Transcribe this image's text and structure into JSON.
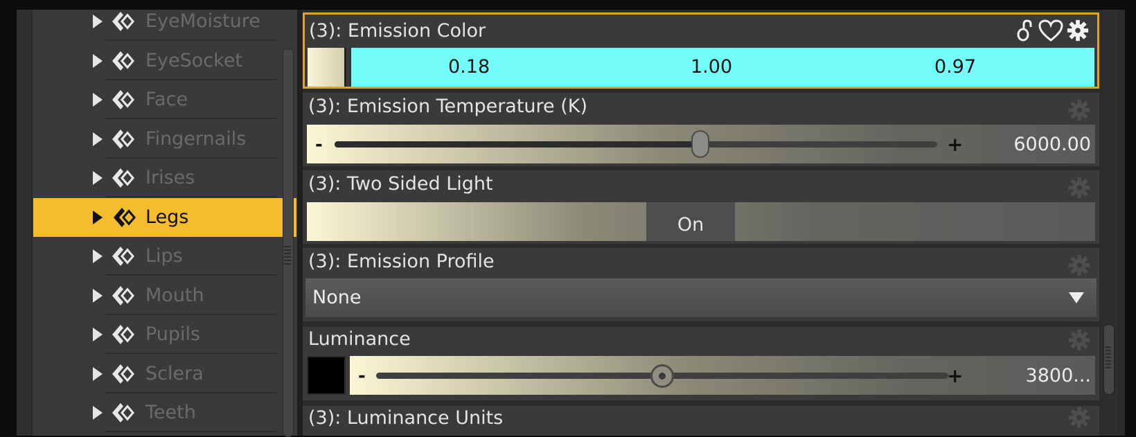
{
  "tree": {
    "items": [
      {
        "label": "EyeMoisture",
        "selected": false
      },
      {
        "label": "EyeSocket",
        "selected": false
      },
      {
        "label": "Face",
        "selected": false
      },
      {
        "label": "Fingernails",
        "selected": false
      },
      {
        "label": "Irises",
        "selected": false
      },
      {
        "label": "Legs",
        "selected": true
      },
      {
        "label": "Lips",
        "selected": false
      },
      {
        "label": "Mouth",
        "selected": false
      },
      {
        "label": "Pupils",
        "selected": false
      },
      {
        "label": "Sclera",
        "selected": false
      },
      {
        "label": "Teeth",
        "selected": false
      }
    ]
  },
  "properties": {
    "emission_color": {
      "title": "(3): Emission Color",
      "r": "0.18",
      "g": "1.00",
      "b": "0.97",
      "swatch_color": "#f7f1d4",
      "bar_color": "#74fcf8"
    },
    "emission_temperature": {
      "title": "(3): Emission Temperature (K)",
      "minus": "-",
      "plus": "+",
      "value": "6000.00",
      "level": 0.6
    },
    "two_sided_light": {
      "title": "(3): Two Sided Light",
      "state": "On"
    },
    "emission_profile": {
      "title": "(3): Emission Profile",
      "selected": "None"
    },
    "luminance": {
      "title": "Luminance",
      "minus": "-",
      "plus": "+",
      "value": "3800...",
      "level": 0.5,
      "swatch_color": "#000000"
    },
    "luminance_units": {
      "title": "(3): Luminance Units"
    }
  },
  "colors": {
    "selection": "#f5bd2e",
    "active_border": "#e0a425"
  },
  "icons": {
    "header": [
      "unlink-icon",
      "heart-icon",
      "gear-icon"
    ],
    "row_gear": "gear-icon",
    "tree_expand": "triangle-right-icon",
    "material": "material-icon"
  }
}
